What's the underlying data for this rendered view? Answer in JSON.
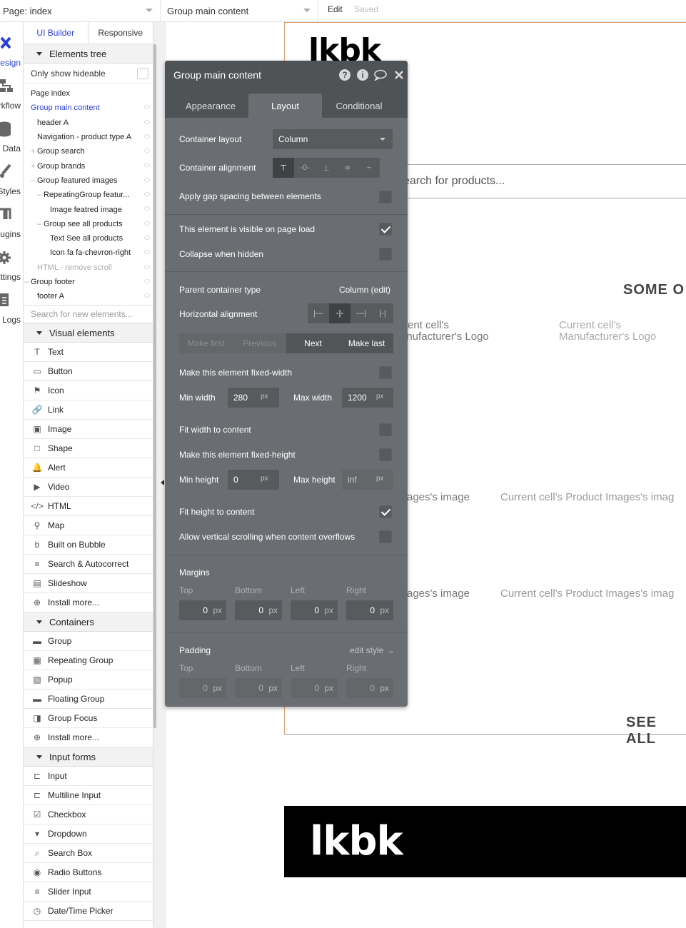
{
  "topbar": {
    "page_label": "Page: index",
    "element_label": "Group main content",
    "edit_label": "Edit",
    "saved_label": "Saved"
  },
  "leftnav": {
    "items": [
      {
        "label": "Design",
        "icon": "design-icon"
      },
      {
        "label": "Workflow",
        "icon": "workflow-icon"
      },
      {
        "label": "Data",
        "icon": "data-icon"
      },
      {
        "label": "Styles",
        "icon": "styles-icon"
      },
      {
        "label": "Plugins",
        "icon": "plugins-icon"
      },
      {
        "label": "Settings",
        "icon": "settings-icon"
      },
      {
        "label": "Logs",
        "icon": "logs-icon"
      }
    ]
  },
  "panel": {
    "tabs": [
      "UI Builder",
      "Responsive"
    ],
    "elements_tree_title": "Elements tree",
    "only_show_hideable": "Only show hideable",
    "tree": [
      {
        "label": "Page index",
        "indent": 0
      },
      {
        "label": "Group main content",
        "indent": 0,
        "selected": true
      },
      {
        "label": "header A",
        "indent": 1
      },
      {
        "label": "Navigation - product type A",
        "indent": 1
      },
      {
        "label": "Group search",
        "indent": 1,
        "expand": "+"
      },
      {
        "label": "Group brands",
        "indent": 1,
        "expand": "+"
      },
      {
        "label": "Group featured images",
        "indent": 1,
        "expand": "-"
      },
      {
        "label": "RepeatingGroup featur...",
        "indent": 2,
        "expand": "-"
      },
      {
        "label": "Image featred image",
        "indent": 3
      },
      {
        "label": "Group see all products",
        "indent": 2,
        "expand": "-"
      },
      {
        "label": "Text See all products",
        "indent": 3
      },
      {
        "label": "Icon fa fa-chevron-right",
        "indent": 3
      },
      {
        "label": "HTML - remove scroll",
        "indent": 1,
        "dim": true
      },
      {
        "label": "Group footer",
        "indent": 0,
        "expand": "-"
      },
      {
        "label": "footer A",
        "indent": 1
      }
    ],
    "search_placeholder": "Search for new elements...",
    "visual_title": "Visual elements",
    "visual": [
      {
        "label": "Text",
        "icon": "text-icon"
      },
      {
        "label": "Button",
        "icon": "button-icon"
      },
      {
        "label": "Icon",
        "icon": "flag-icon"
      },
      {
        "label": "Link",
        "icon": "link-icon"
      },
      {
        "label": "Image",
        "icon": "image-icon"
      },
      {
        "label": "Shape",
        "icon": "shape-icon"
      },
      {
        "label": "Alert",
        "icon": "bell-icon"
      },
      {
        "label": "Video",
        "icon": "video-icon"
      },
      {
        "label": "HTML",
        "icon": "code-icon"
      },
      {
        "label": "Map",
        "icon": "map-pin-icon"
      },
      {
        "label": "Built on Bubble",
        "icon": "bubble-icon"
      },
      {
        "label": "Search & Autocorrect",
        "icon": "search-doc-icon"
      },
      {
        "label": "Slideshow",
        "icon": "slideshow-icon"
      },
      {
        "label": "Install more...",
        "icon": "plus-circle-icon"
      }
    ],
    "containers_title": "Containers",
    "containers": [
      {
        "label": "Group",
        "icon": "folder-icon"
      },
      {
        "label": "Repeating Group",
        "icon": "repeating-group-icon"
      },
      {
        "label": "Popup",
        "icon": "popup-icon"
      },
      {
        "label": "Floating Group",
        "icon": "floating-group-icon"
      },
      {
        "label": "Group Focus",
        "icon": "group-focus-icon"
      },
      {
        "label": "Install more...",
        "icon": "plus-circle-icon"
      }
    ],
    "inputs_title": "Input forms",
    "inputs": [
      {
        "label": "Input",
        "icon": "input-icon"
      },
      {
        "label": "Multiline Input",
        "icon": "multiline-input-icon"
      },
      {
        "label": "Checkbox",
        "icon": "checkbox-icon"
      },
      {
        "label": "Dropdown",
        "icon": "dropdown-icon"
      },
      {
        "label": "Search Box",
        "icon": "search-icon"
      },
      {
        "label": "Radio Buttons",
        "icon": "radio-icon"
      },
      {
        "label": "Slider Input",
        "icon": "slider-icon"
      },
      {
        "label": "Date/Time Picker",
        "icon": "clock-icon"
      }
    ]
  },
  "canvas": {
    "logo_text": "lkbk",
    "search_text": "earch for products...",
    "heading_some": "SOME O",
    "cell_logo_1a": "rrent cell's",
    "cell_logo_1b": "anufacturer's Logo",
    "cell_logo_2a": "Current cell's",
    "cell_logo_2b": "Manufacturer's Logo",
    "img_1a": "ages's image",
    "img_1b": "Current cell's Product Images's imag",
    "img_2a": "ages's image",
    "img_2b": "Current cell's Product Images's imag",
    "see_all": "SEE ALL",
    "footer_logo": "lkbk"
  },
  "inspector": {
    "title": "Group main content",
    "tabs": [
      "Appearance",
      "Layout",
      "Conditional"
    ],
    "container_layout_label": "Container layout",
    "container_layout_value": "Column",
    "container_alignment_label": "Container alignment",
    "gap_label": "Apply gap spacing between elements",
    "visible_label": "This element is visible on page load",
    "collapse_label": "Collapse when hidden",
    "parent_type_label": "Parent container type",
    "parent_type_value": "Column (edit)",
    "horiz_align_label": "Horizontal alignment",
    "order": [
      "Make first",
      "Previous",
      "Next",
      "Make last"
    ],
    "fixed_width_label": "Make this element fixed-width",
    "min_width_label": "Min width",
    "min_width_value": "280",
    "max_width_label": "Max width",
    "max_width_value": "1200",
    "unit": "px",
    "fit_width_label": "Fit width to content",
    "fixed_height_label": "Make this element fixed-height",
    "min_height_label": "Min height",
    "min_height_value": "0",
    "max_height_label": "Max height",
    "max_height_value": "inf",
    "fit_height_label": "Fit height to content",
    "scroll_label": "Allow vertical scrolling when content overflows",
    "margins_label": "Margins",
    "padding_label": "Padding",
    "edit_style": "edit style →",
    "sides": [
      "Top",
      "Bottom",
      "Left",
      "Right"
    ],
    "margin_values": [
      "0",
      "0",
      "0",
      "0"
    ],
    "padding_values": [
      "0",
      "0",
      "0",
      "0"
    ]
  }
}
